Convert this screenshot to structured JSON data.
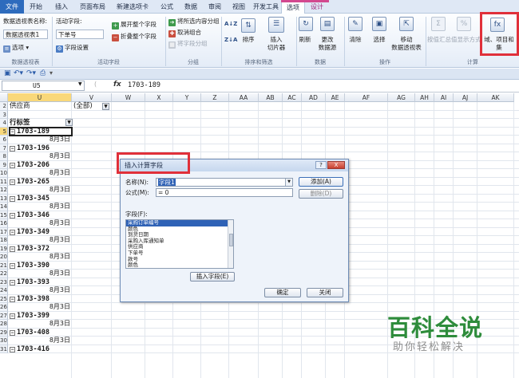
{
  "ribbon_tabs": [
    {
      "label": "文件",
      "kind": "file"
    },
    {
      "label": "开始"
    },
    {
      "label": "插入"
    },
    {
      "label": "页面布局"
    },
    {
      "label": "新建选项卡"
    },
    {
      "label": "公式"
    },
    {
      "label": "数据"
    },
    {
      "label": "审阅"
    },
    {
      "label": "视图"
    },
    {
      "label": "开发工具"
    },
    {
      "label": "选项",
      "active": true
    },
    {
      "label": "设计",
      "contextual": true
    }
  ],
  "ribbon": {
    "pivot_name_label": "数据透视表名称:",
    "pivot_name_value": "数据透视表1",
    "options_button": "选项",
    "pivot_group": "数据透视表",
    "active_field_label": "活动字段:",
    "active_field_value": "下单号",
    "field_settings": "字段设置",
    "expand_field": "展开整个字段",
    "collapse_field": "折叠整个字段",
    "active_field_group": "活动字段",
    "group_selection": "将所选内容分组",
    "ungroup": "取消组合",
    "group_field": "将字段分组",
    "group_group": "分组",
    "sort_asc": "A↓Z",
    "sort_desc": "Z↓A",
    "sort": "排序",
    "insert_slicer": "插入",
    "insert_slicer_2": "切片器",
    "sort_filter_group": "排序和筛选",
    "refresh": "刷新",
    "change_source": "更改",
    "change_source_2": "数据源",
    "data_group": "数据",
    "clear": "清除",
    "select": "选择",
    "move": "移动",
    "move_2": "数据透视表",
    "actions_group": "操作",
    "summarize": "按值汇总",
    "show_values": "值显示方式",
    "fields_items": "域、项目和",
    "fields_items_2": "集",
    "calc_group": "计算"
  },
  "formula_bar": {
    "name_box": "U5",
    "fx": "fx",
    "value": "1703-189"
  },
  "columns": [
    "U",
    "V",
    "W",
    "X",
    "Y",
    "Z",
    "AA",
    "AB",
    "AC",
    "AD",
    "AE",
    "AF",
    "AG",
    "AH",
    "AI",
    "AJ",
    "AK"
  ],
  "rows": [
    {
      "n": "2",
      "u": "供应商",
      "v": "(全部)",
      "t": "filter"
    },
    {
      "n": "3",
      "u": "",
      "t": "blank"
    },
    {
      "n": "4",
      "u": "行标签",
      "t": "header"
    },
    {
      "n": "5",
      "u": "1703-189",
      "t": "group",
      "sel": true
    },
    {
      "n": "6",
      "u": "8月3日",
      "t": "sub"
    },
    {
      "n": "7",
      "u": "1703-196",
      "t": "group"
    },
    {
      "n": "8",
      "u": "8月3日",
      "t": "sub"
    },
    {
      "n": "9",
      "u": "1703-206",
      "t": "group"
    },
    {
      "n": "10",
      "u": "8月3日",
      "t": "sub"
    },
    {
      "n": "11",
      "u": "1703-265",
      "t": "group"
    },
    {
      "n": "12",
      "u": "8月3日",
      "t": "sub"
    },
    {
      "n": "13",
      "u": "1703-345",
      "t": "group"
    },
    {
      "n": "14",
      "u": "8月3日",
      "t": "sub"
    },
    {
      "n": "15",
      "u": "1703-346",
      "t": "group"
    },
    {
      "n": "16",
      "u": "8月3日",
      "t": "sub"
    },
    {
      "n": "17",
      "u": "1703-349",
      "t": "group"
    },
    {
      "n": "18",
      "u": "8月3日",
      "t": "sub"
    },
    {
      "n": "19",
      "u": "1703-372",
      "t": "group"
    },
    {
      "n": "20",
      "u": "8月3日",
      "t": "sub"
    },
    {
      "n": "21",
      "u": "1703-390",
      "t": "group"
    },
    {
      "n": "22",
      "u": "8月3日",
      "t": "sub"
    },
    {
      "n": "23",
      "u": "1703-393",
      "t": "group"
    },
    {
      "n": "24",
      "u": "8月3日",
      "t": "sub"
    },
    {
      "n": "25",
      "u": "1703-398",
      "t": "group"
    },
    {
      "n": "26",
      "u": "8月3日",
      "t": "sub"
    },
    {
      "n": "27",
      "u": "1703-399",
      "t": "group"
    },
    {
      "n": "28",
      "u": "8月3日",
      "t": "sub"
    },
    {
      "n": "29",
      "u": "1703-408",
      "t": "group"
    },
    {
      "n": "30",
      "u": "8月3日",
      "t": "sub"
    },
    {
      "n": "31",
      "u": "1703-416",
      "t": "group"
    }
  ],
  "dialog": {
    "title": "插入计算字段",
    "help": "?",
    "close": "X",
    "name_label": "名称(N):",
    "name_value": "字段1",
    "formula_label": "公式(M):",
    "formula_value": "= 0",
    "add_button": "添加(A)",
    "delete_button": "删除(D)",
    "fields_label": "字段(F):",
    "fields": [
      "采购订单编号",
      "颜色",
      "到货日期",
      "采购入库通知单",
      "供应商",
      "下单号",
      "款号",
      "颜色"
    ],
    "insert_field_button": "插入字段(E)",
    "ok_button": "确定",
    "close_button": "关闭"
  },
  "watermark": {
    "title": "百科全说",
    "subtitle": "助你轻松解决"
  }
}
